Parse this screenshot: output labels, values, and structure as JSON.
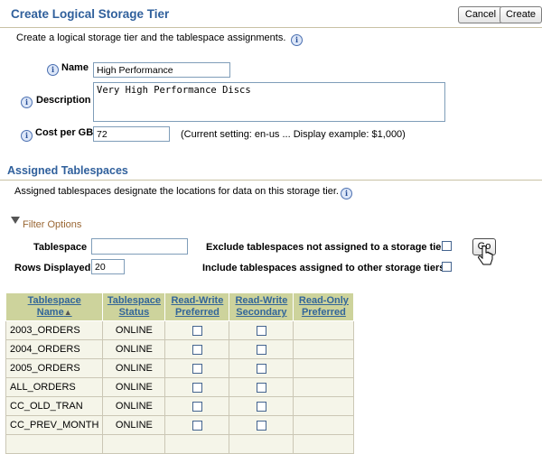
{
  "header": {
    "title": "Create Logical Storage Tier",
    "cancel_label": "Cancel",
    "create_label": "Create"
  },
  "intro": "Create a logical storage tier and the tablespace assignments.",
  "form": {
    "name_label": "Name",
    "name_value": "High Performance",
    "description_label": "Description",
    "description_value": "Very High Performance Discs",
    "cost_label": "Cost per GB",
    "cost_value": "72",
    "cost_hint": "(Current setting: en-us ... Display example: $1,000)"
  },
  "assigned": {
    "heading": "Assigned Tablespaces",
    "description": "Assigned tablespaces designate the locations for data on this storage tier."
  },
  "filter": {
    "toggle_label": "Filter Options",
    "tablespace_label": "Tablespace",
    "tablespace_value": "",
    "rows_label": "Rows Displayed",
    "rows_value": "20",
    "exclude_label": "Exclude tablespaces not assigned to a storage tier",
    "include_label": "Include tablespaces assigned to other storage tiers",
    "go_label": "Go"
  },
  "table": {
    "columns": [
      {
        "line1": "Tablespace",
        "line2": "Name"
      },
      {
        "line1": "Tablespace",
        "line2": "Status"
      },
      {
        "line1": "Read-Write",
        "line2": "Preferred"
      },
      {
        "line1": "Read-Write",
        "line2": "Secondary"
      },
      {
        "line1": "Read-Only",
        "line2": "Preferred"
      }
    ],
    "sort_indicator": "▲",
    "rows": [
      {
        "name": "2003_ORDERS",
        "status": "ONLINE"
      },
      {
        "name": "2004_ORDERS",
        "status": "ONLINE"
      },
      {
        "name": "2005_ORDERS",
        "status": "ONLINE"
      },
      {
        "name": "ALL_ORDERS",
        "status": "ONLINE"
      },
      {
        "name": "CC_OLD_TRAN",
        "status": "ONLINE"
      },
      {
        "name": "CC_PREV_MONTH",
        "status": "ONLINE"
      },
      {
        "name": "",
        "status": ""
      }
    ]
  },
  "icons": {
    "info": "info-icon",
    "triangle": "triangle-down-icon",
    "cursor": "hand-cursor-icon"
  },
  "colors": {
    "title": "#30609c",
    "table_header": "#cdd39c",
    "table_cell": "#f5f5e9",
    "filter_link": "#996633"
  }
}
